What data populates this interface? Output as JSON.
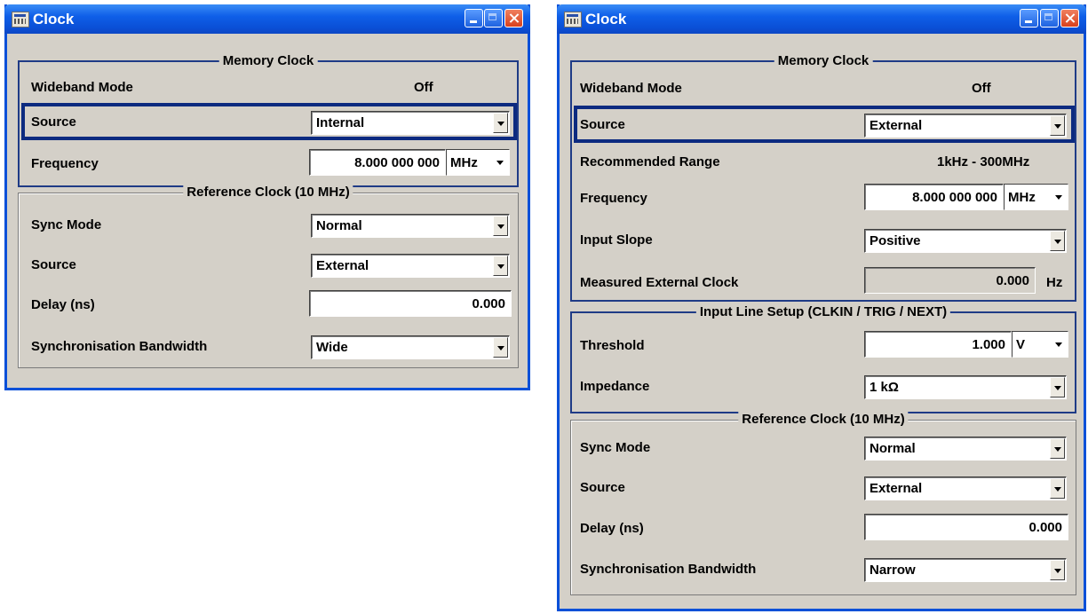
{
  "window1": {
    "title": "Clock",
    "memory_clock": {
      "legend": "Memory Clock",
      "wideband_label": "Wideband Mode",
      "wideband_value": "Off",
      "source_label": "Source",
      "source_value": "Internal",
      "frequency_label": "Frequency",
      "frequency_value": "8.000 000 000",
      "frequency_unit": "MHz"
    },
    "reference_clock": {
      "legend": "Reference Clock (10 MHz)",
      "sync_mode_label": "Sync Mode",
      "sync_mode_value": "Normal",
      "source_label": "Source",
      "source_value": "External",
      "delay_label": "Delay (ns)",
      "delay_value": "0.000",
      "bandwidth_label": "Synchronisation Bandwidth",
      "bandwidth_value": "Wide"
    }
  },
  "window2": {
    "title": "Clock",
    "memory_clock": {
      "legend": "Memory Clock",
      "wideband_label": "Wideband Mode",
      "wideband_value": "Off",
      "source_label": "Source",
      "source_value": "External",
      "range_label": "Recommended Range",
      "range_value": "1kHz - 300MHz",
      "frequency_label": "Frequency",
      "frequency_value": "8.000 000 000",
      "frequency_unit": "MHz",
      "slope_label": "Input Slope",
      "slope_value": "Positive",
      "measured_label": "Measured External Clock",
      "measured_value": "0.000",
      "measured_unit": "Hz"
    },
    "input_line": {
      "legend": "Input Line Setup (CLKIN / TRIG / NEXT)",
      "threshold_label": "Threshold",
      "threshold_value": "1.000",
      "threshold_unit": "V",
      "impedance_label": "Impedance",
      "impedance_value": "1 kΩ"
    },
    "reference_clock": {
      "legend": "Reference Clock (10 MHz)",
      "sync_mode_label": "Sync Mode",
      "sync_mode_value": "Normal",
      "source_label": "Source",
      "source_value": "External",
      "delay_label": "Delay (ns)",
      "delay_value": "0.000",
      "bandwidth_label": "Synchronisation Bandwidth",
      "bandwidth_value": "Narrow"
    }
  },
  "icons": [
    "app-icon",
    "minimize-icon",
    "maximize-icon",
    "close-icon",
    "chevron-down-icon"
  ]
}
